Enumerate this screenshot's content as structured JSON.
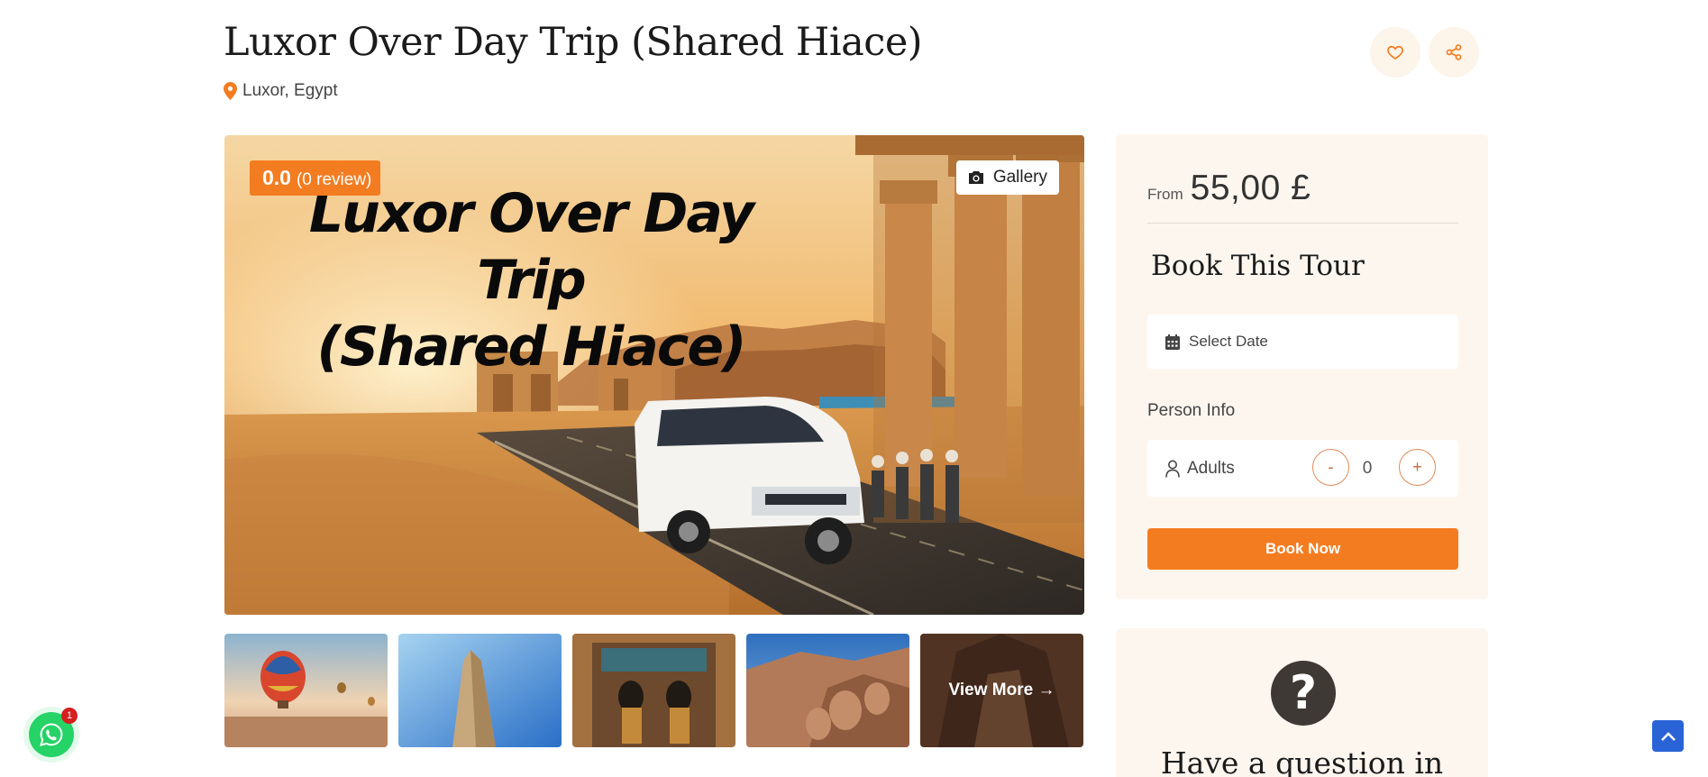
{
  "tour": {
    "title": "Luxor Over Day Trip (Shared Hiace)",
    "location": "Luxor, Egypt"
  },
  "header": {
    "wishlist_icon": "heart-icon",
    "share_icon": "share-icon"
  },
  "hero": {
    "caption_line1": "Luxor Over Day Trip",
    "caption_line2": "(Shared Hiace)",
    "rating_score": "0.0",
    "rating_count": "(0 review)",
    "gallery_label": "Gallery"
  },
  "thumbnails": {
    "view_more_label": "View More →",
    "items": [
      "hot-air-balloons",
      "obelisk",
      "tomb-painting",
      "temple-statues",
      "cave-interior"
    ]
  },
  "booking": {
    "price_from": "From",
    "price_value": "55,00 £",
    "section_title": "Book This Tour",
    "date_placeholder": "Select Date",
    "person_info_label": "Person Info",
    "adults_label": "Adults",
    "decrement_label": "-",
    "increment_label": "+",
    "adults_count": "0",
    "book_now_label": "Book Now"
  },
  "question": {
    "icon": "question-mark-icon",
    "heading": "Have a question in"
  },
  "floating": {
    "whatsapp_badge": "1"
  },
  "colors": {
    "accent": "#f47c20",
    "highlight": "#f7d21b",
    "panel_bg": "#fdf6ef",
    "whatsapp": "#25d366",
    "scroll_top": "#2a63d6"
  }
}
